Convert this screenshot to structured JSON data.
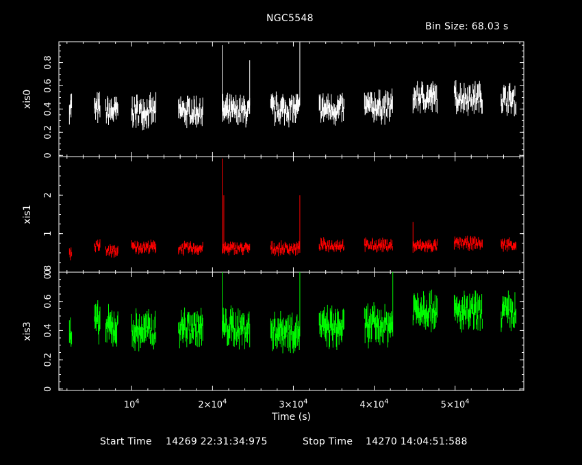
{
  "header": {
    "title": "NGC5548",
    "bin_size": "Bin Size: 68.03 s"
  },
  "footer": {
    "start_label": "Start Time",
    "start_value": "14269 22:31:34:975",
    "stop_label": "Stop Time",
    "stop_value": "14270 14:04:51:588"
  },
  "chart_data": {
    "type": "scatter",
    "title": "NGC5548",
    "xlabel": "Time (s)",
    "xlim": [
      1000,
      58500
    ],
    "x_ticks": [
      {
        "value": 10000,
        "label": "10^4"
      },
      {
        "value": 20000,
        "label": "2×10^4"
      },
      {
        "value": 30000,
        "label": "3×10^4"
      },
      {
        "value": 40000,
        "label": "4×10^4"
      },
      {
        "value": 50000,
        "label": "5×10^4"
      }
    ],
    "grid": false,
    "segments": [
      [
        2300,
        2600
      ],
      [
        5400,
        6100
      ],
      [
        6800,
        8300
      ],
      [
        10000,
        13000
      ],
      [
        15800,
        18800
      ],
      [
        21200,
        24600
      ],
      [
        27200,
        30800
      ],
      [
        33200,
        36300
      ],
      [
        38800,
        42300
      ],
      [
        44800,
        47800
      ],
      [
        49900,
        53400
      ],
      [
        55700,
        57600
      ]
    ],
    "panels": [
      {
        "name": "xis0",
        "color": "#ffffff",
        "ylim": [
          -0.01,
          0.98
        ],
        "yticks": [
          0,
          0.2,
          0.4,
          0.6,
          0.8
        ],
        "levels": [
          0.43,
          0.4,
          0.38,
          0.38,
          0.38,
          0.38,
          0.4,
          0.4,
          0.42,
          0.5,
          0.5,
          0.48
        ],
        "spread": 0.08,
        "spikes": [
          [
            21200,
            0.95
          ],
          [
            24600,
            0.82
          ],
          [
            30800,
            0.98
          ]
        ]
      },
      {
        "name": "xis1",
        "color": "#ff0000",
        "ylim": [
          0.0,
          3.0
        ],
        "yticks": [
          0,
          1,
          2
        ],
        "levels": [
          0.5,
          0.68,
          0.55,
          0.65,
          0.62,
          0.62,
          0.62,
          0.7,
          0.7,
          0.68,
          0.75,
          0.72
        ],
        "spread": 0.1,
        "spikes": [
          [
            21200,
            2.95
          ],
          [
            21400,
            2.0
          ],
          [
            30800,
            2.0
          ],
          [
            44800,
            1.3
          ]
        ]
      },
      {
        "name": "xis3",
        "color": "#00ff00",
        "ylim": [
          -0.01,
          0.8
        ],
        "yticks": [
          0,
          0.2,
          0.4,
          0.6,
          0.8
        ],
        "levels": [
          0.36,
          0.45,
          0.42,
          0.4,
          0.42,
          0.42,
          0.4,
          0.42,
          0.44,
          0.55,
          0.52,
          0.52
        ],
        "spread": 0.08,
        "spikes": [
          [
            21200,
            0.8
          ],
          [
            30800,
            0.82
          ],
          [
            42300,
            0.82
          ]
        ]
      }
    ]
  }
}
